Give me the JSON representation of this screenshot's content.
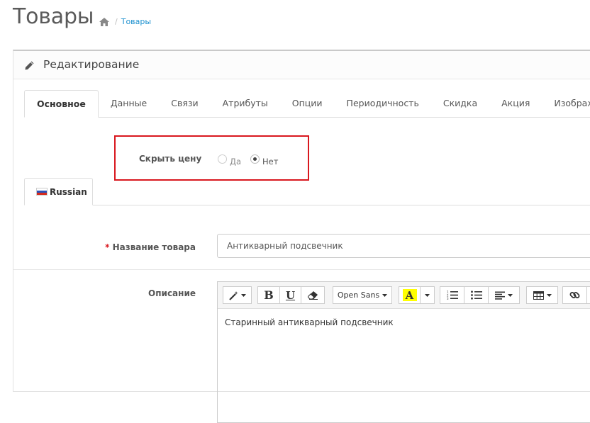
{
  "header": {
    "title": "Товары",
    "breadcrumb": {
      "home_icon": "home-icon",
      "separator": "/",
      "current": "Товары"
    }
  },
  "panel": {
    "title": "Редактирование",
    "title_icon": "pencil-icon"
  },
  "tabs": [
    {
      "label": "Основное",
      "active": true
    },
    {
      "label": "Данные"
    },
    {
      "label": "Связи"
    },
    {
      "label": "Атрибуты"
    },
    {
      "label": "Опции"
    },
    {
      "label": "Периодичность"
    },
    {
      "label": "Скидка"
    },
    {
      "label": "Акция"
    },
    {
      "label": "Изображения"
    }
  ],
  "hide_price": {
    "label": "Скрыть цену",
    "options": [
      {
        "label": "Да",
        "checked": false
      },
      {
        "label": "Нет",
        "checked": true
      }
    ],
    "highlight_color": "#d9171e"
  },
  "language_tab": {
    "label": "Russian",
    "flag_icon": "russia-flag-icon"
  },
  "product_name": {
    "label": "Название товара",
    "required_marker": "*",
    "value": "Антикварный подсвечник"
  },
  "description": {
    "label": "Описание",
    "content": "Старинный антикварный подсвечник",
    "toolbar": {
      "style_icon": "magic-wand-icon",
      "bold": "B",
      "underline": "U",
      "eraser_icon": "eraser-icon",
      "font_name": "Open Sans",
      "color_letter": "A",
      "color_highlight": "#ffff00",
      "ordered_list_icon": "ordered-list-icon",
      "unordered_list_icon": "unordered-list-icon",
      "align_icon": "align-left-icon",
      "table_icon": "table-icon",
      "link_icon": "link-icon"
    }
  },
  "colors": {
    "link": "#1e91cf",
    "required": "#d9171e"
  }
}
